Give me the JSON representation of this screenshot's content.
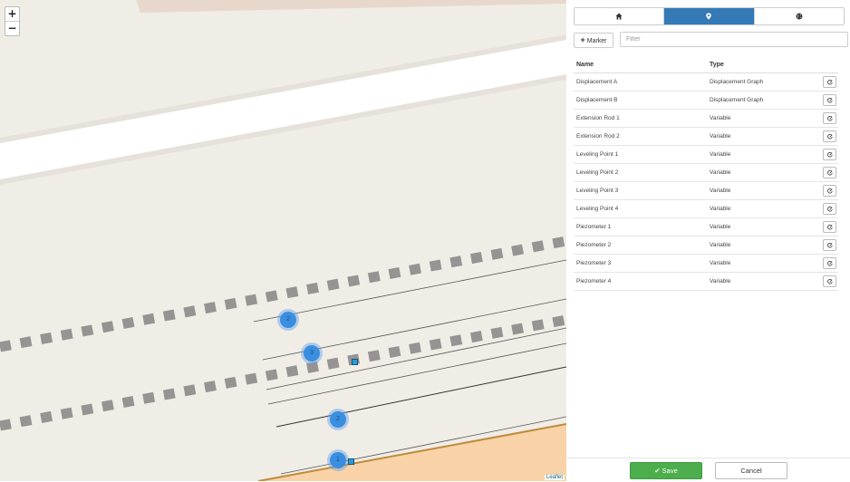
{
  "map": {
    "zoom_in_label": "+",
    "zoom_out_label": "−",
    "markers": [
      "2",
      "3",
      "2",
      "1"
    ],
    "attribution": "Leaflet"
  },
  "tabs": [
    {
      "icon": "home-icon",
      "active": false
    },
    {
      "icon": "map-marker-icon",
      "active": true
    },
    {
      "icon": "globe-icon",
      "active": false
    }
  ],
  "toolbar": {
    "add_marker_label": "Marker",
    "filter_placeholder": "Filter"
  },
  "table": {
    "headers": {
      "name": "Name",
      "type": "Type"
    },
    "rows": [
      {
        "name": "Displacement A",
        "type": "Displacement Graph"
      },
      {
        "name": "Displacement B",
        "type": "Displacement Graph"
      },
      {
        "name": "Extension Rod 1",
        "type": "Variable"
      },
      {
        "name": "Extension Rod 2",
        "type": "Variable"
      },
      {
        "name": "Leveling Point 1",
        "type": "Variable"
      },
      {
        "name": "Leveling Point 2",
        "type": "Variable"
      },
      {
        "name": "Leveling Point 3",
        "type": "Variable"
      },
      {
        "name": "Leveling Point 4",
        "type": "Variable"
      },
      {
        "name": "Piezometer 1",
        "type": "Variable"
      },
      {
        "name": "Piezometer 2",
        "type": "Variable"
      },
      {
        "name": "Piezometer 3",
        "type": "Variable"
      },
      {
        "name": "Piezometer 4",
        "type": "Variable"
      }
    ]
  },
  "footer": {
    "save_label": "Save",
    "cancel_label": "Cancel"
  },
  "colors": {
    "primary": "#337ab7",
    "success": "#4cae4c",
    "marker": "#3a8ee0",
    "map_bg": "#f0ede7",
    "building": "#f9d3a7"
  }
}
